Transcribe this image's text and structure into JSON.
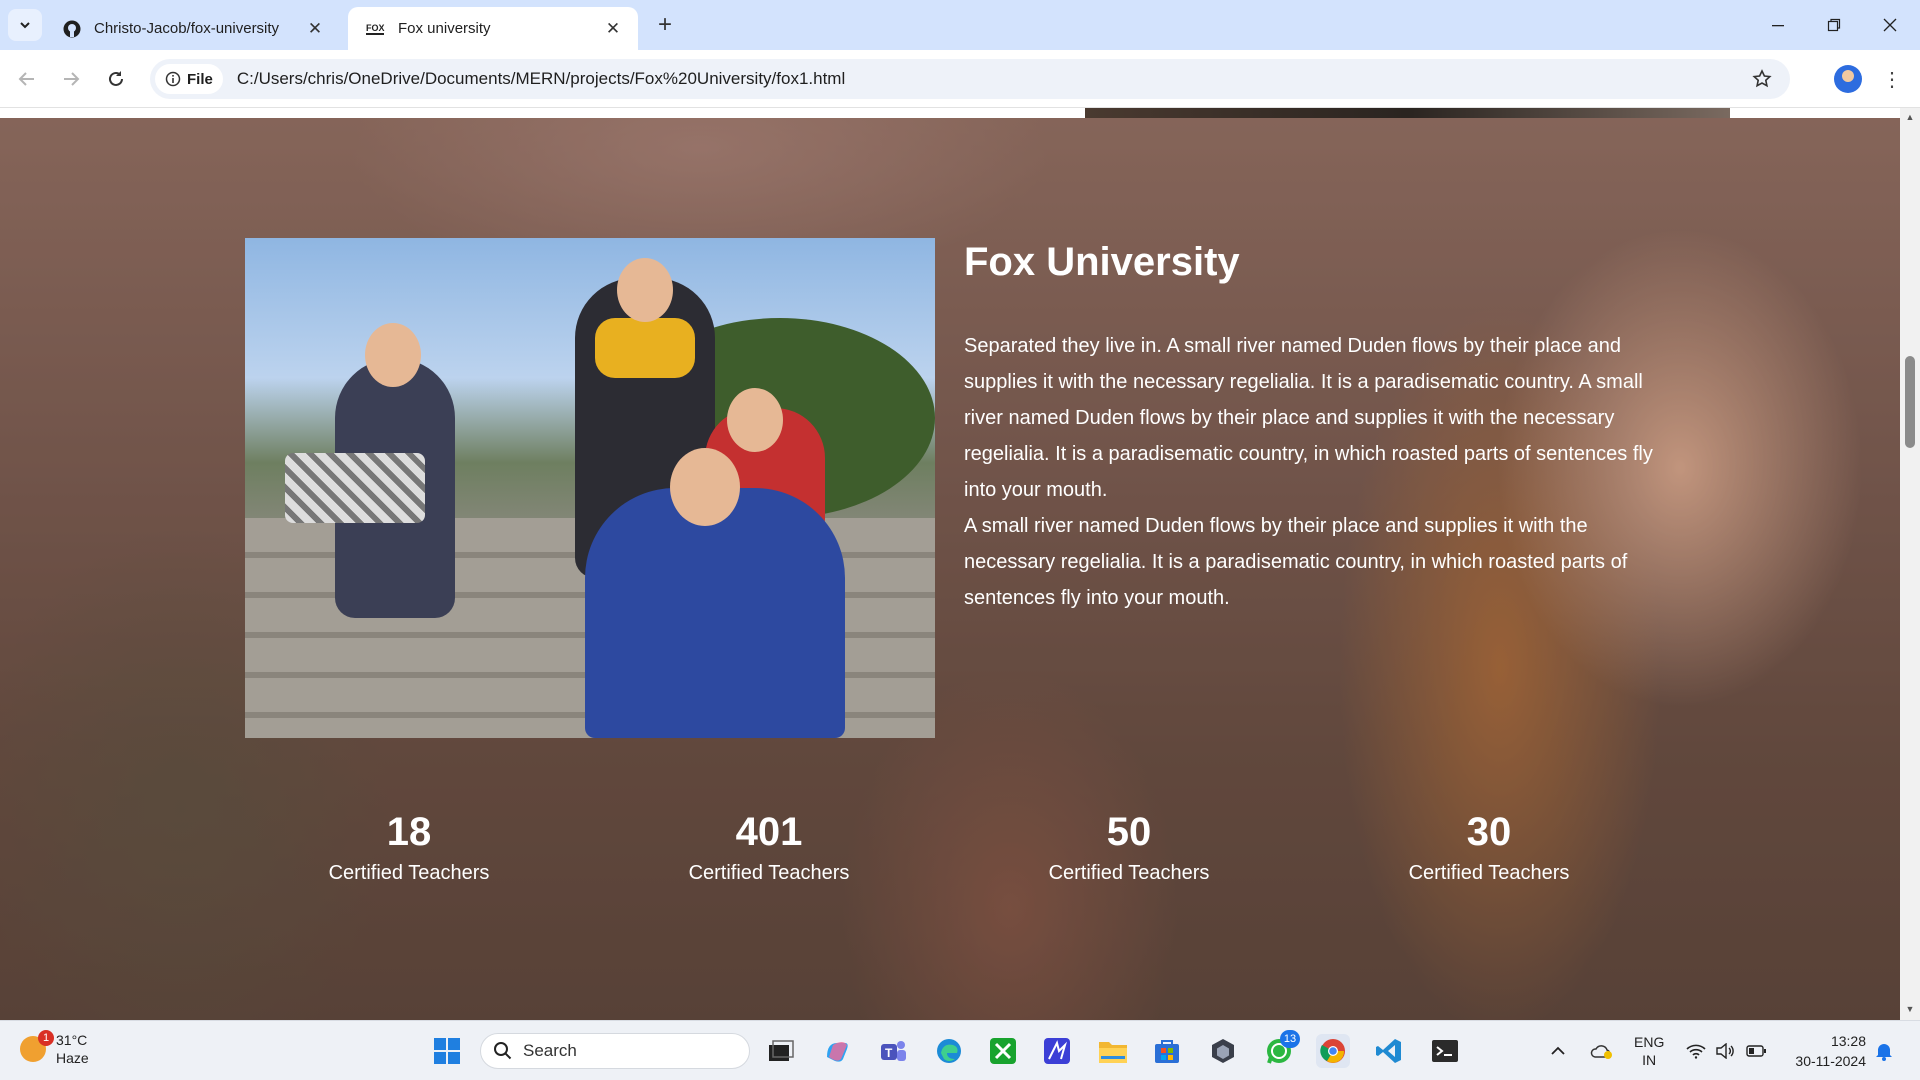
{
  "browser": {
    "tabs": [
      {
        "title": "Christo-Jacob/fox-university",
        "favicon": "github-icon"
      },
      {
        "title": "Fox university",
        "favicon": "fox-icon"
      }
    ],
    "omnibox": {
      "chip_label": "File",
      "url": "C:/Users/chris/OneDrive/Documents/MERN/projects/Fox%20University/fox1.html"
    }
  },
  "page": {
    "heading": "Fox University",
    "paragraph_1": "Separated they live in. A small river named Duden flows by their place and supplies it with the necessary regelialia. It is a paradisematic country. A small river named Duden flows by their place and supplies it with the necessary regelialia. It is a paradisematic country, in which roasted parts of sentences fly into your mouth.",
    "paragraph_2": "A small river named Duden flows by their place and supplies it with the necessary regelialia. It is a paradisematic country, in which roasted parts of sentences fly into your mouth.",
    "stats": [
      {
        "number": "18",
        "label": "Certified Teachers"
      },
      {
        "number": "401",
        "label": "Certified Teachers"
      },
      {
        "number": "50",
        "label": "Certified Teachers"
      },
      {
        "number": "30",
        "label": "Certified Teachers"
      }
    ]
  },
  "taskbar": {
    "weather": {
      "temp": "31°C",
      "condition": "Haze",
      "badge": "1"
    },
    "search_placeholder": "Search",
    "whatsapp_badge": "13",
    "language": {
      "line1": "ENG",
      "line2": "IN"
    },
    "clock": {
      "time": "13:28",
      "date": "30-11-2024"
    }
  }
}
